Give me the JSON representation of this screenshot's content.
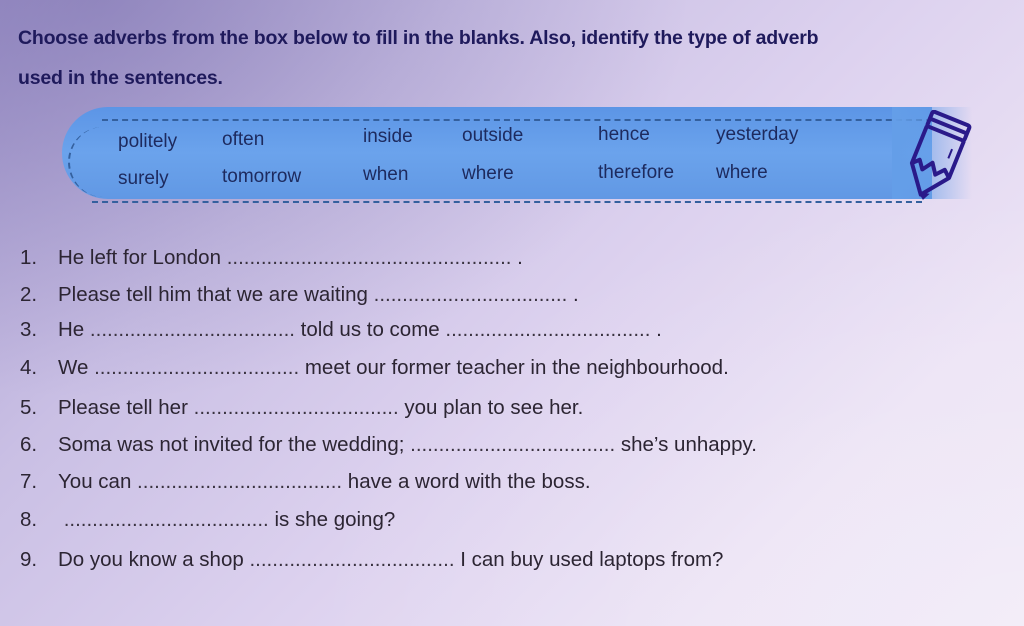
{
  "instruction": {
    "line1": "Choose adverbs from the box below to fill in the blanks. Also, identify the type of adverb",
    "line2": "used in the sentences."
  },
  "word_box": {
    "row1": [
      "politely",
      "often",
      "inside",
      "outside",
      "hence",
      "yesterday"
    ],
    "row2": [
      "surely",
      "tomorrow",
      "when",
      "where",
      "therefore",
      "where"
    ],
    "icon": "pencil-icon"
  },
  "exercises": [
    {
      "num": "1.",
      "before": "He left for London",
      "blank": "..................................................",
      "after": " ."
    },
    {
      "num": "2.",
      "before": "Please tell him that we are waiting",
      "blank": "..................................",
      "after": " ."
    },
    {
      "num": "3.",
      "before": "He",
      "blank": "....................................",
      "after": "told us to come",
      "blank2": "....................................",
      "after2": " ."
    },
    {
      "num": "4.",
      "before": "We",
      "blank": "....................................",
      "after": "meet our former teacher in the neighbourhood."
    },
    {
      "num": "5.",
      "before": "Please tell her",
      "blank": "....................................",
      "after": "you plan to see her."
    },
    {
      "num": "6.",
      "before": "Soma was not invited for the wedding;",
      "blank": "....................................",
      "after": "she’s unhappy."
    },
    {
      "num": "7.",
      "before": "You can",
      "blank": "....................................",
      "after": "have a word with the boss."
    },
    {
      "num": "8.",
      "before": "",
      "blank": "....................................",
      "after": "is she going?"
    },
    {
      "num": "9.",
      "before": "Do you know a shop",
      "blank": "....................................",
      "after": "I can buy used laptops from?"
    }
  ]
}
